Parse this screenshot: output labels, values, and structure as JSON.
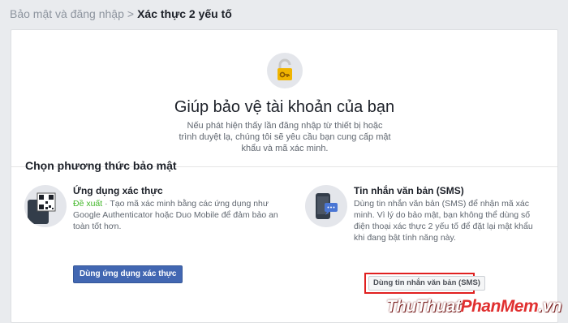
{
  "breadcrumb": {
    "parent": "Bảo mật và đăng nhập",
    "separator": ">",
    "current": "Xác thực 2 yếu tố"
  },
  "hero": {
    "icon": "lock-key-icon",
    "title": "Giúp bảo vệ tài khoản của bạn",
    "description": "Nếu phát hiện thấy lần đăng nhập từ thiết bị hoặc trình duyệt lạ, chúng tôi sẽ yêu cầu bạn cung cấp mật khẩu và mã xác minh."
  },
  "methods": {
    "section_title": "Chọn phương thức bảo mật",
    "auth_app": {
      "icon": "qr-phone-icon",
      "title": "Ứng dụng xác thực",
      "badge": "Đề xuất",
      "description": " · Tạo mã xác minh bằng các ứng dụng như Google Authenticator hoặc Duo Mobile để đảm bảo an toàn tốt hơn.",
      "button_label": "Dùng ứng dụng xác thực"
    },
    "sms": {
      "icon": "phone-message-icon",
      "title": "Tin nhắn văn bản (SMS)",
      "description": "Dùng tin nhắn văn bản (SMS) để nhận mã xác minh. Vì lý do bảo mật, bạn không thể dùng số điện thoại xác thực 2 yếu tố để đặt lại mật khẩu khi đang bật tính năng này.",
      "button_label": "Dùng tin nhắn văn bản (SMS)"
    }
  },
  "watermark": {
    "part1": "ThuThuat",
    "part2": "PhanMem",
    "part3": ".vn"
  },
  "colors": {
    "primary_button": "#4267b2",
    "recommended": "#42b72a",
    "highlight": "#e02020"
  }
}
